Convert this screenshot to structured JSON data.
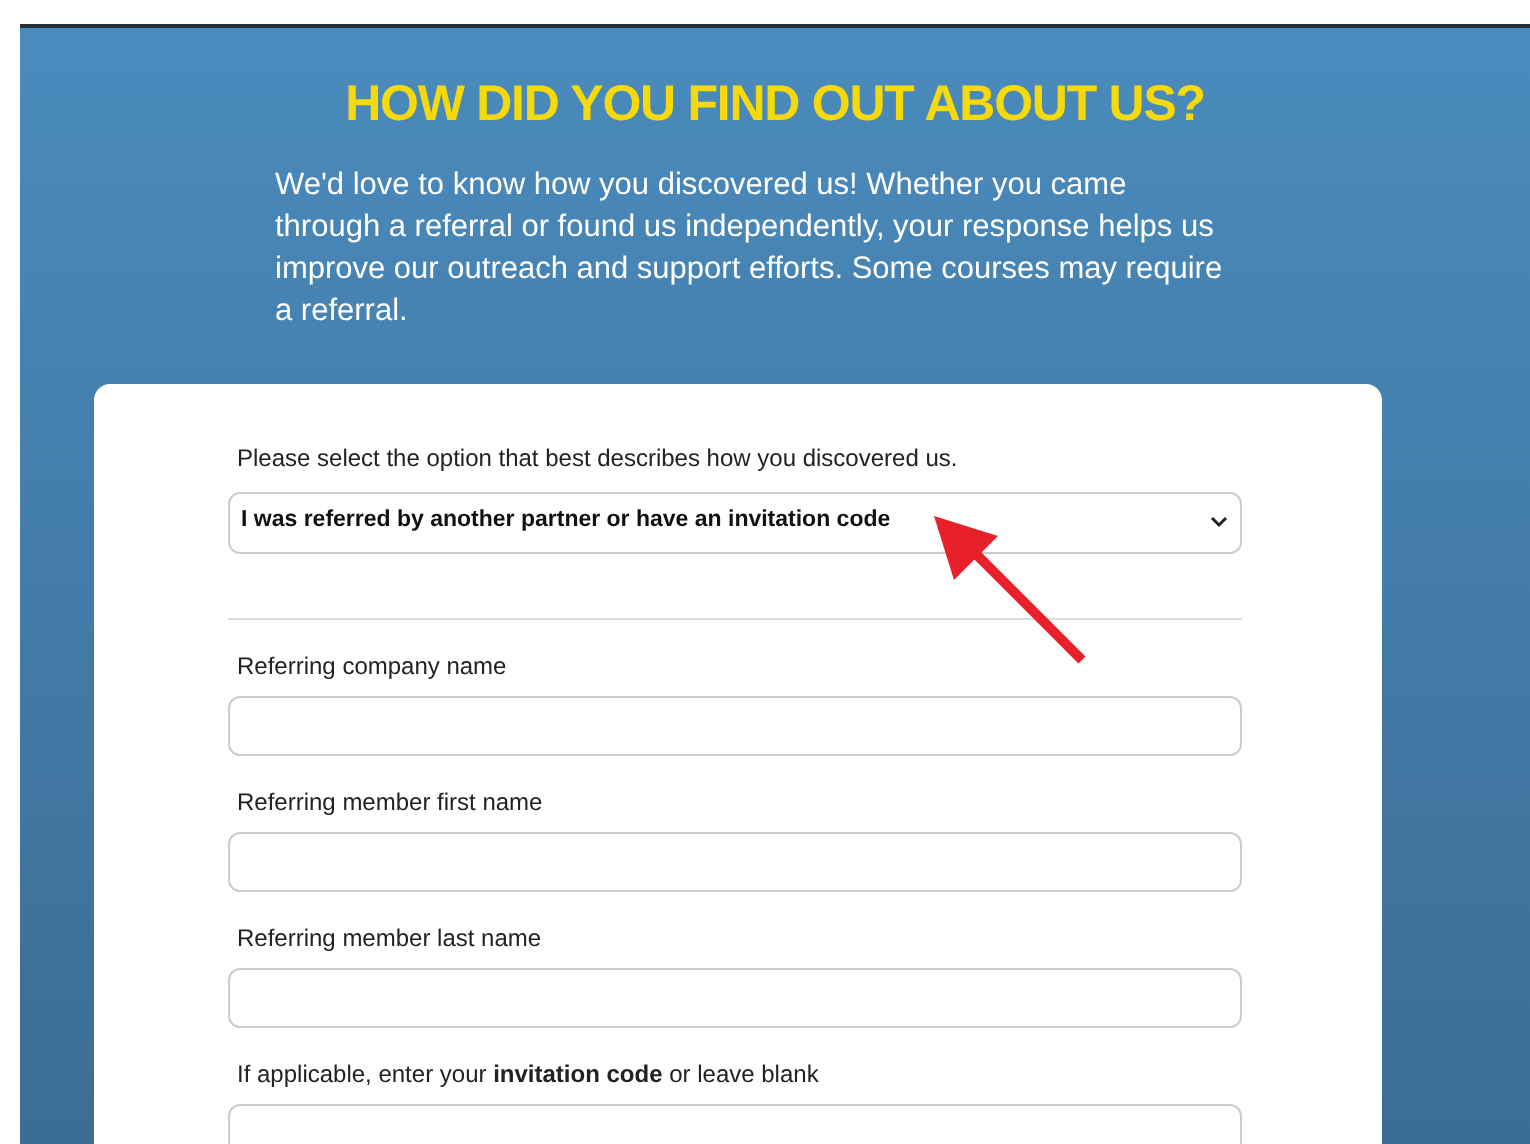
{
  "heading": "HOW DID YOU FIND OUT ABOUT US?",
  "intro": "We'd love to know how you discovered us! Whether you came through a referral or found us independently, your response helps us improve our outreach and support efforts. Some courses may require a referral.",
  "select": {
    "label": "Please select the option that best describes how you discovered us.",
    "value": "I was referred by another partner or have an invitation code"
  },
  "fields": [
    {
      "label": "Referring company name"
    },
    {
      "label": "Referring member first name"
    },
    {
      "label": "Referring member last name"
    },
    {
      "label": "If applicable, enter your **invitation code** or leave blank"
    }
  ]
}
